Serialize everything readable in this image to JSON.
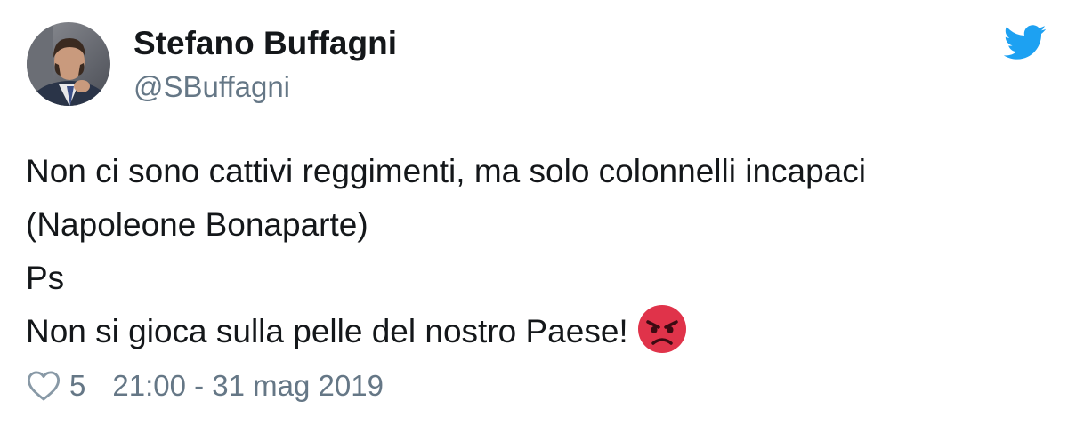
{
  "tweet": {
    "display_name": "Stefano Buffagni",
    "handle": "@SBuffagni",
    "lines": [
      "Non ci sono cattivi reggimenti, ma solo colonnelli incapaci",
      "(Napoleone Bonaparte)",
      "Ps",
      "Non si gioca sulla pelle del nostro Paese!"
    ],
    "emoji": "angry-face-icon",
    "like_count": "5",
    "timestamp": "21:00 - 31 mag 2019"
  },
  "icons": {
    "brand": "twitter-bird-icon",
    "like": "heart-icon"
  },
  "colors": {
    "twitter_blue": "#1da1f2",
    "text_primary": "#14171a",
    "text_secondary": "#657786",
    "emoji_red": "#e0334a"
  }
}
